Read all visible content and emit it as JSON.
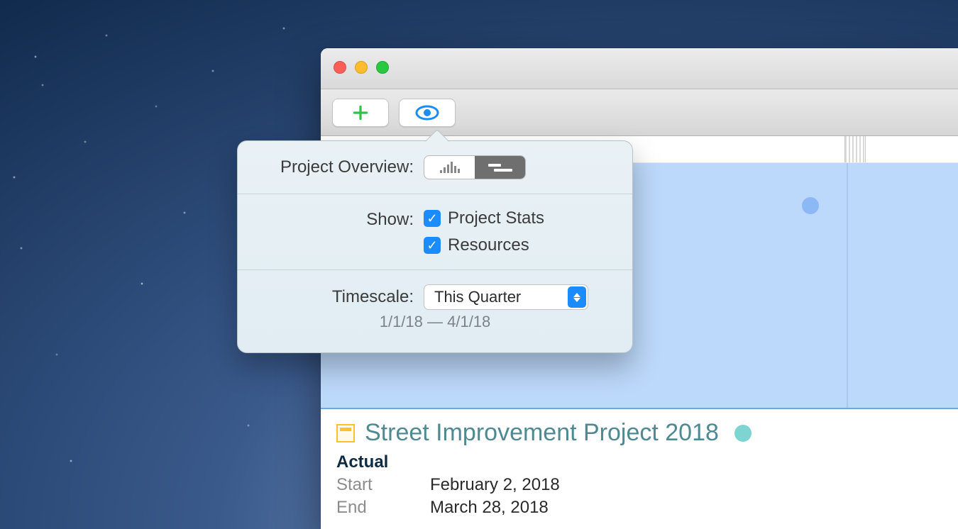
{
  "popover": {
    "overview_label": "Project Overview:",
    "show_label": "Show:",
    "show_items": {
      "project_stats": "Project Stats",
      "resources": "Resources"
    },
    "timescale_label": "Timescale:",
    "timescale_value": "This Quarter",
    "timescale_range": "1/1/18 — 4/1/18"
  },
  "project": {
    "title": "Street Improvement Project 2018",
    "section": "Actual",
    "start_label": "Start",
    "start_value": "February 2, 2018",
    "end_label": "End",
    "end_value": "March 28, 2018"
  }
}
